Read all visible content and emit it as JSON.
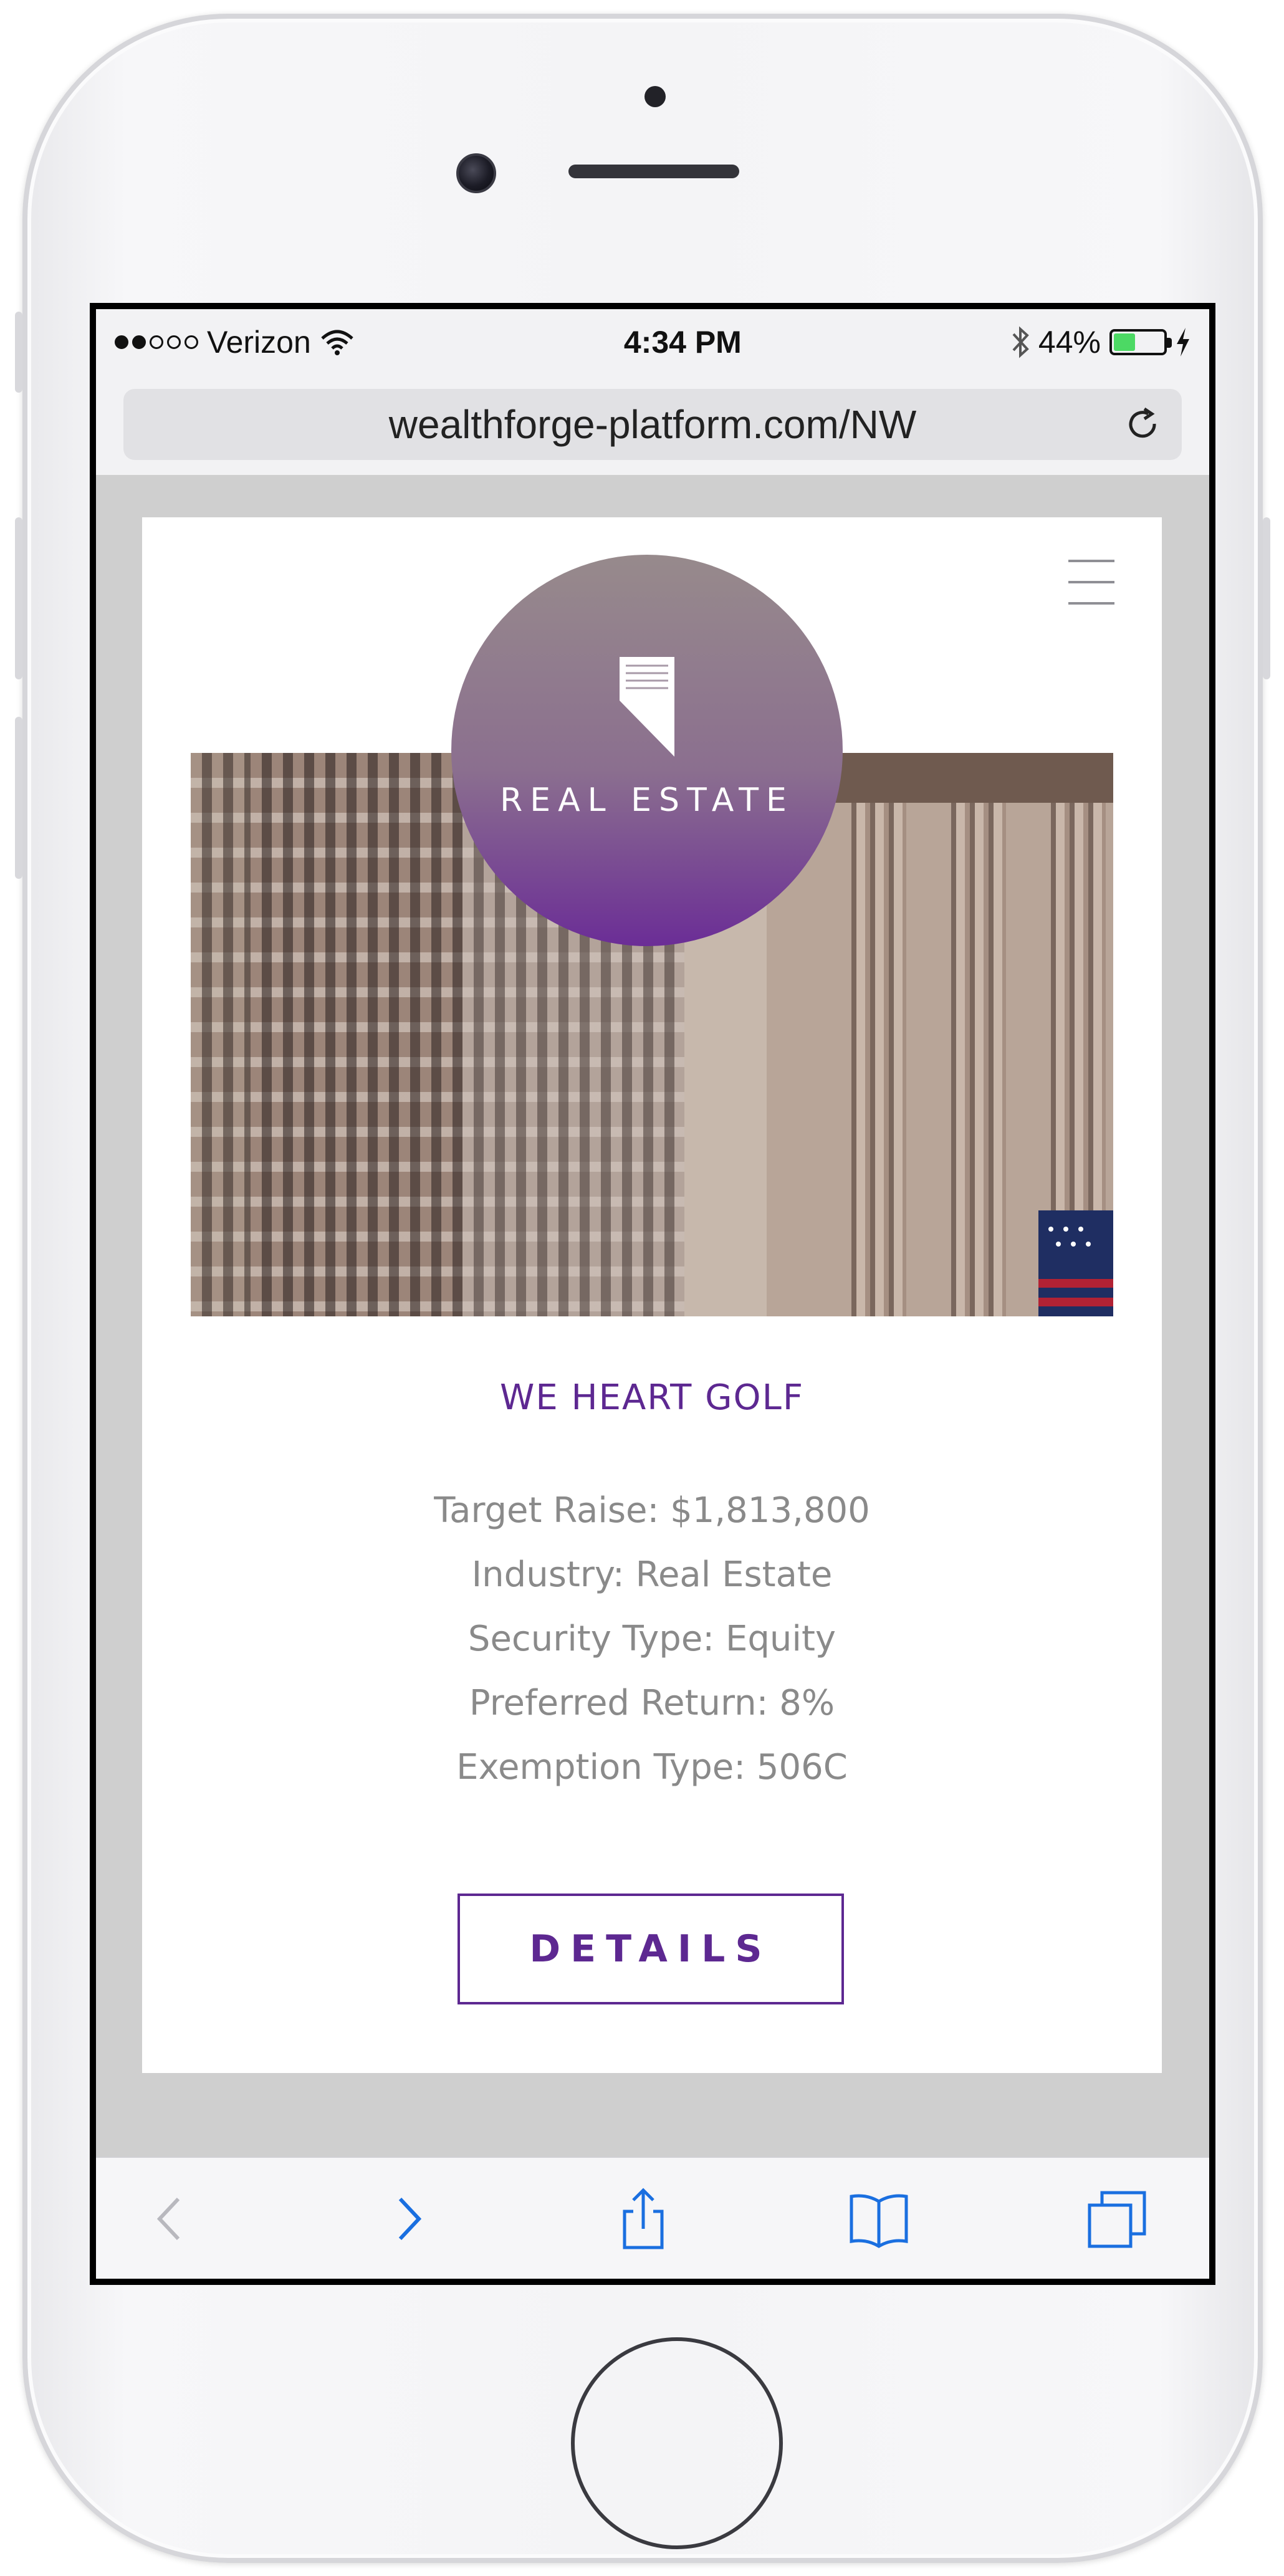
{
  "status_bar": {
    "carrier": "Verizon",
    "time": "4:34 PM",
    "battery": "44%",
    "battery_level": 0.44
  },
  "browser": {
    "url": "wealthforge-platform.com/NW"
  },
  "listing": {
    "category": "REAL ESTATE",
    "title": "WE HEART GOLF",
    "facts": [
      "Target Raise: $1,813,800",
      "Industry: Real Estate",
      "Security Type: Equity",
      "Preferred Return: 8%",
      "Exemption Type: 506C"
    ],
    "details_label": "DETAILS"
  },
  "colors": {
    "accent": "#5d2891",
    "ios_blue": "#1a6fe0",
    "battery_green": "#4cd964"
  },
  "icons": {
    "reload": "reload-icon",
    "menu": "hamburger-menu-icon",
    "badge": "document-icon",
    "toolbar": [
      "back-icon",
      "forward-icon",
      "share-icon",
      "bookmarks-icon",
      "tabs-icon"
    ]
  }
}
